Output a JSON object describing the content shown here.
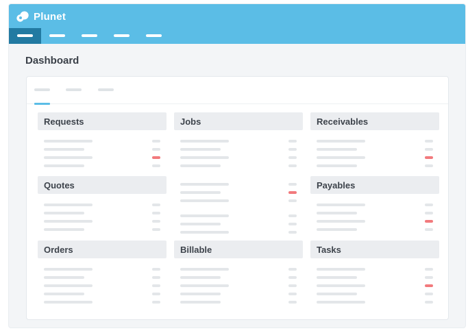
{
  "app": {
    "name": "Plunet",
    "logo_icon": "plunet-logo-icon"
  },
  "nav": {
    "active_index": 0,
    "item_count": 5
  },
  "page": {
    "title": "Dashboard"
  },
  "tabs": {
    "active_index": 0,
    "item_count": 3
  },
  "colors": {
    "header": "#5bbde6",
    "active_nav": "#227aa2",
    "alert": "#f27a7d",
    "widget_header": "#ebedf0",
    "placeholder": "#e3e6e9"
  },
  "widgets": [
    {
      "title": "Requests"
    },
    {
      "title": "Jobs"
    },
    {
      "title": "Receivables"
    },
    {
      "title": "Quotes"
    },
    {
      "title": ""
    },
    {
      "title": "Payables"
    },
    {
      "title": "Orders"
    },
    {
      "title": "Billable"
    },
    {
      "title": "Tasks"
    }
  ]
}
